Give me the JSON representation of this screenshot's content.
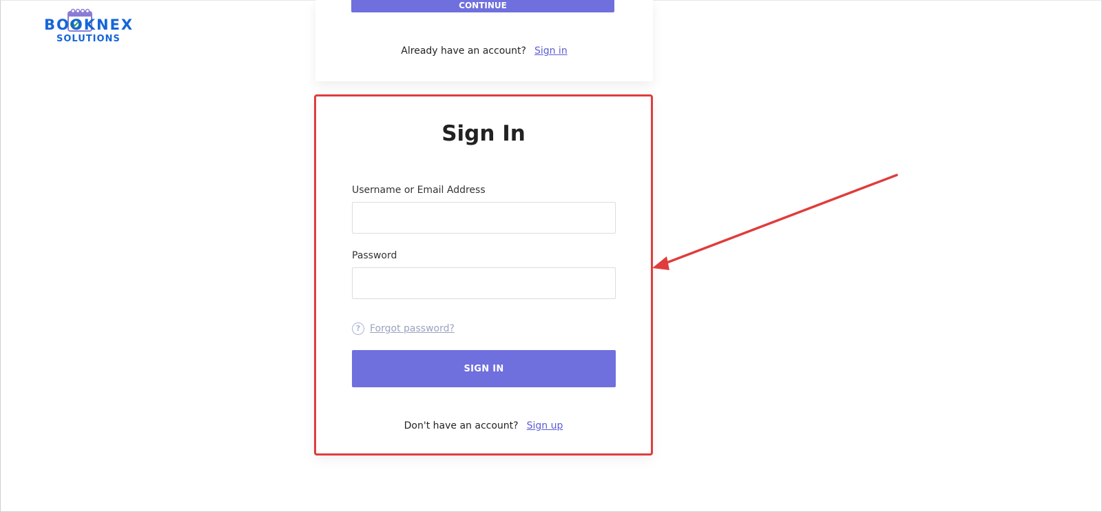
{
  "logo": {
    "word": "BOOKNEX",
    "sub": "SOLUTIONS",
    "icon": "calendar-check-icon",
    "color": "#1565d8"
  },
  "register_card": {
    "continue_label": "CONTINUE",
    "have_account_text": "Already have an account?",
    "signin_link": "Sign in"
  },
  "signin_card": {
    "title": "Sign In",
    "username_label": "Username or Email Address",
    "username_value": "",
    "password_label": "Password",
    "password_value": "",
    "forgot_icon": "question-circle-icon",
    "forgot_link": "Forgot password?",
    "signin_button": "SIGN IN",
    "no_account_text": "Don't have an account?",
    "signup_link": "Sign up"
  },
  "colors": {
    "accent": "#6f6fde",
    "annotation": "#e03c3c",
    "link": "#5b5bd6"
  }
}
